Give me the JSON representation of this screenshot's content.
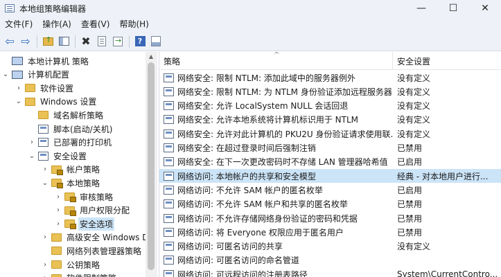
{
  "window": {
    "title": "本地组策略编辑器",
    "minimize": "—",
    "maximize": "☐",
    "close": "✕"
  },
  "menu": [
    "文件(F)",
    "操作(A)",
    "查看(V)",
    "帮助(H)"
  ],
  "toolbar": {
    "back_glyph": "⇦",
    "forward_glyph": "⇨",
    "delete_glyph": "✖",
    "help_glyph": "?"
  },
  "tree": [
    {
      "label": "本地计算机 策略",
      "depth": 0,
      "chevron": "",
      "icon": "computer"
    },
    {
      "label": "计算机配置",
      "depth": 0,
      "chevron": "⌄",
      "icon": "computer"
    },
    {
      "label": "软件设置",
      "depth": 1,
      "chevron": "›",
      "icon": "folder"
    },
    {
      "label": "Windows 设置",
      "depth": 1,
      "chevron": "⌄",
      "icon": "folder"
    },
    {
      "label": "域名解析策略",
      "depth": 2,
      "chevron": "",
      "icon": "folder"
    },
    {
      "label": "脚本(启动/关机)",
      "depth": 2,
      "chevron": "",
      "icon": "policy"
    },
    {
      "label": "已部署的打印机",
      "depth": 2,
      "chevron": "›",
      "icon": "policy"
    },
    {
      "label": "安全设置",
      "depth": 2,
      "chevron": "⌄",
      "icon": "policy"
    },
    {
      "label": "帐户策略",
      "depth": 3,
      "chevron": "›",
      "icon": "folder-lock"
    },
    {
      "label": "本地策略",
      "depth": 3,
      "chevron": "⌄",
      "icon": "folder-lock"
    },
    {
      "label": "审核策略",
      "depth": 4,
      "chevron": "›",
      "icon": "folder-lock"
    },
    {
      "label": "用户权限分配",
      "depth": 4,
      "chevron": "›",
      "icon": "folder-lock"
    },
    {
      "label": "安全选项",
      "depth": 4,
      "chevron": "›",
      "icon": "folder-lock",
      "selected": true
    },
    {
      "label": "高级安全 Windows D",
      "depth": 3,
      "chevron": "›",
      "icon": "folder"
    },
    {
      "label": "网络列表管理器策略",
      "depth": 3,
      "chevron": "",
      "icon": "folder"
    },
    {
      "label": "公钥策略",
      "depth": 3,
      "chevron": "›",
      "icon": "folder"
    },
    {
      "label": "软件限制策略",
      "depth": 3,
      "chevron": "›",
      "icon": "folder"
    }
  ],
  "list": {
    "columns": {
      "policy": "策略",
      "setting": "安全设置"
    },
    "sort_caret": "^",
    "rows": [
      {
        "policy": "网络安全: 限制 NTLM: 添加此域中的服务器例外",
        "setting": "没有定义"
      },
      {
        "policy": "网络安全: 限制 NTLM: 为 NTLM 身份验证添加远程服务器...",
        "setting": "没有定义"
      },
      {
        "policy": "网络安全: 允许 LocalSystem NULL 会话回退",
        "setting": "没有定义"
      },
      {
        "policy": "网络安全: 允许本地系统将计算机标识用于 NTLM",
        "setting": "没有定义"
      },
      {
        "policy": "网络安全: 允许对此计算机的 PKU2U 身份验证请求使用联...",
        "setting": "没有定义"
      },
      {
        "policy": "网络安全: 在超过登录时间后强制注销",
        "setting": "已禁用"
      },
      {
        "policy": "网络安全: 在下一次更改密码时不存储 LAN 管理器哈希值",
        "setting": "已启用"
      },
      {
        "policy": "网络访问: 本地帐户的共享和安全模型",
        "setting": "经典 - 对本地用户进行...",
        "selected": true
      },
      {
        "policy": "网络访问: 不允许 SAM 帐户的匿名枚举",
        "setting": "已启用"
      },
      {
        "policy": "网络访问: 不允许 SAM 帐户和共享的匿名枚举",
        "setting": "已禁用"
      },
      {
        "policy": "网络访问: 不允许存储网络身份验证的密码和凭据",
        "setting": "已禁用"
      },
      {
        "policy": "网络访问: 将 Everyone 权限应用于匿名用户",
        "setting": "已禁用"
      },
      {
        "policy": "网络访问: 可匿名访问的共享",
        "setting": "没有定义"
      },
      {
        "policy": "网络访问: 可匿名访问的命名管道",
        "setting": ""
      },
      {
        "policy": "网络访问: 可远程访问的注册表路径",
        "setting": "System\\CurrentContro..."
      }
    ]
  }
}
